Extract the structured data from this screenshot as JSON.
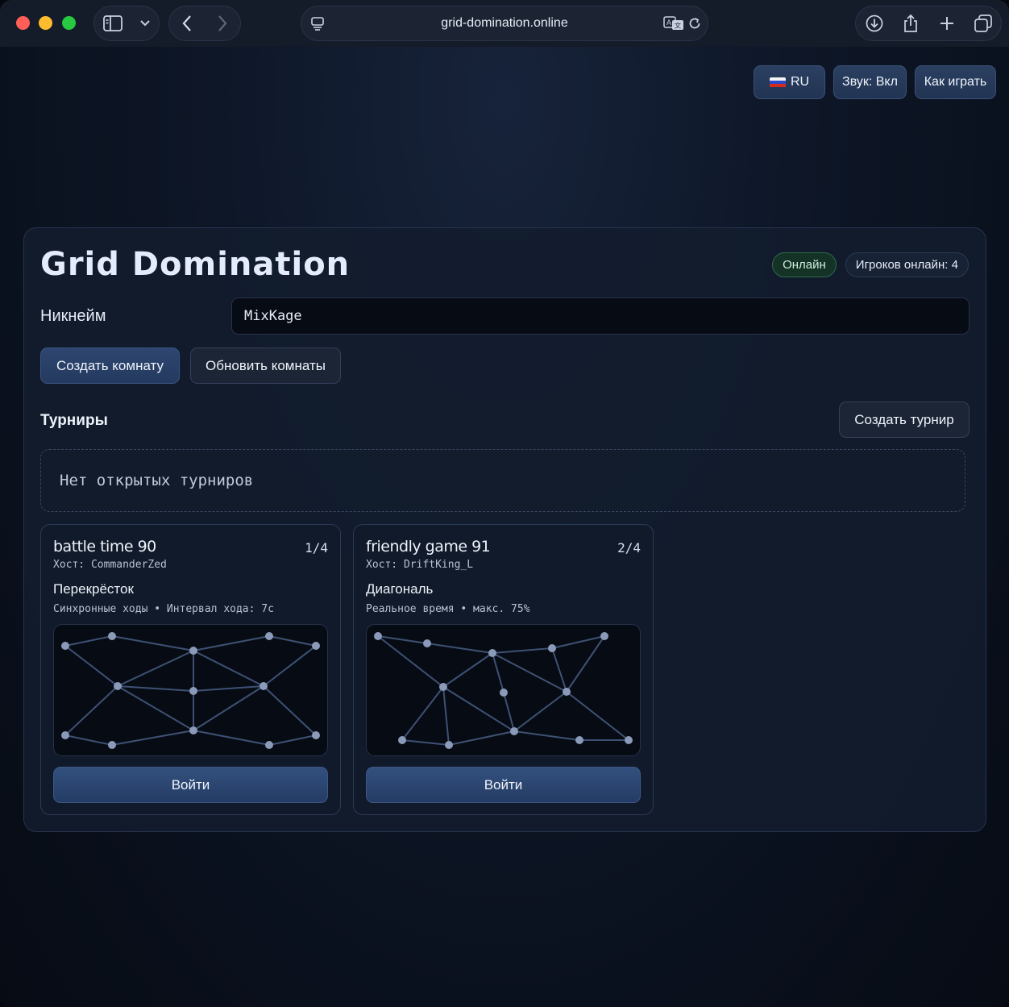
{
  "browser": {
    "url": "grid-domination.online"
  },
  "header": {
    "lang_label": "RU",
    "sound_label": "Звук: Вкл",
    "help_label": "Как играть"
  },
  "lobby": {
    "title": "Grid Domination",
    "status": "Онлайн",
    "players_online": "Игроков онлайн: 4",
    "nickname_label": "Никнейм",
    "nickname_value": "MixKage",
    "create_room": "Создать комнату",
    "refresh_rooms": "Обновить комнаты",
    "tournaments_title": "Турниры",
    "create_tournament": "Создать турнир",
    "no_tournaments": "Нет открытых турниров"
  },
  "rooms": [
    {
      "name": "battle time 90",
      "players": "1/4",
      "host": "Хост: CommanderZed",
      "map": "Перекрёсток",
      "mode": "Синхронные ходы • Интервал хода: 7с",
      "join": "Войти"
    },
    {
      "name": "friendly game 91",
      "players": "2/4",
      "host": "Хост: DriftKing_L",
      "map": "Диагональ",
      "mode": "Реальное время • макс. 75%",
      "join": "Войти"
    }
  ],
  "colors": {
    "accent": "#2e4670",
    "online": "#2f6b4a",
    "node": "#8a9ab8",
    "edge": "#3e5174"
  }
}
